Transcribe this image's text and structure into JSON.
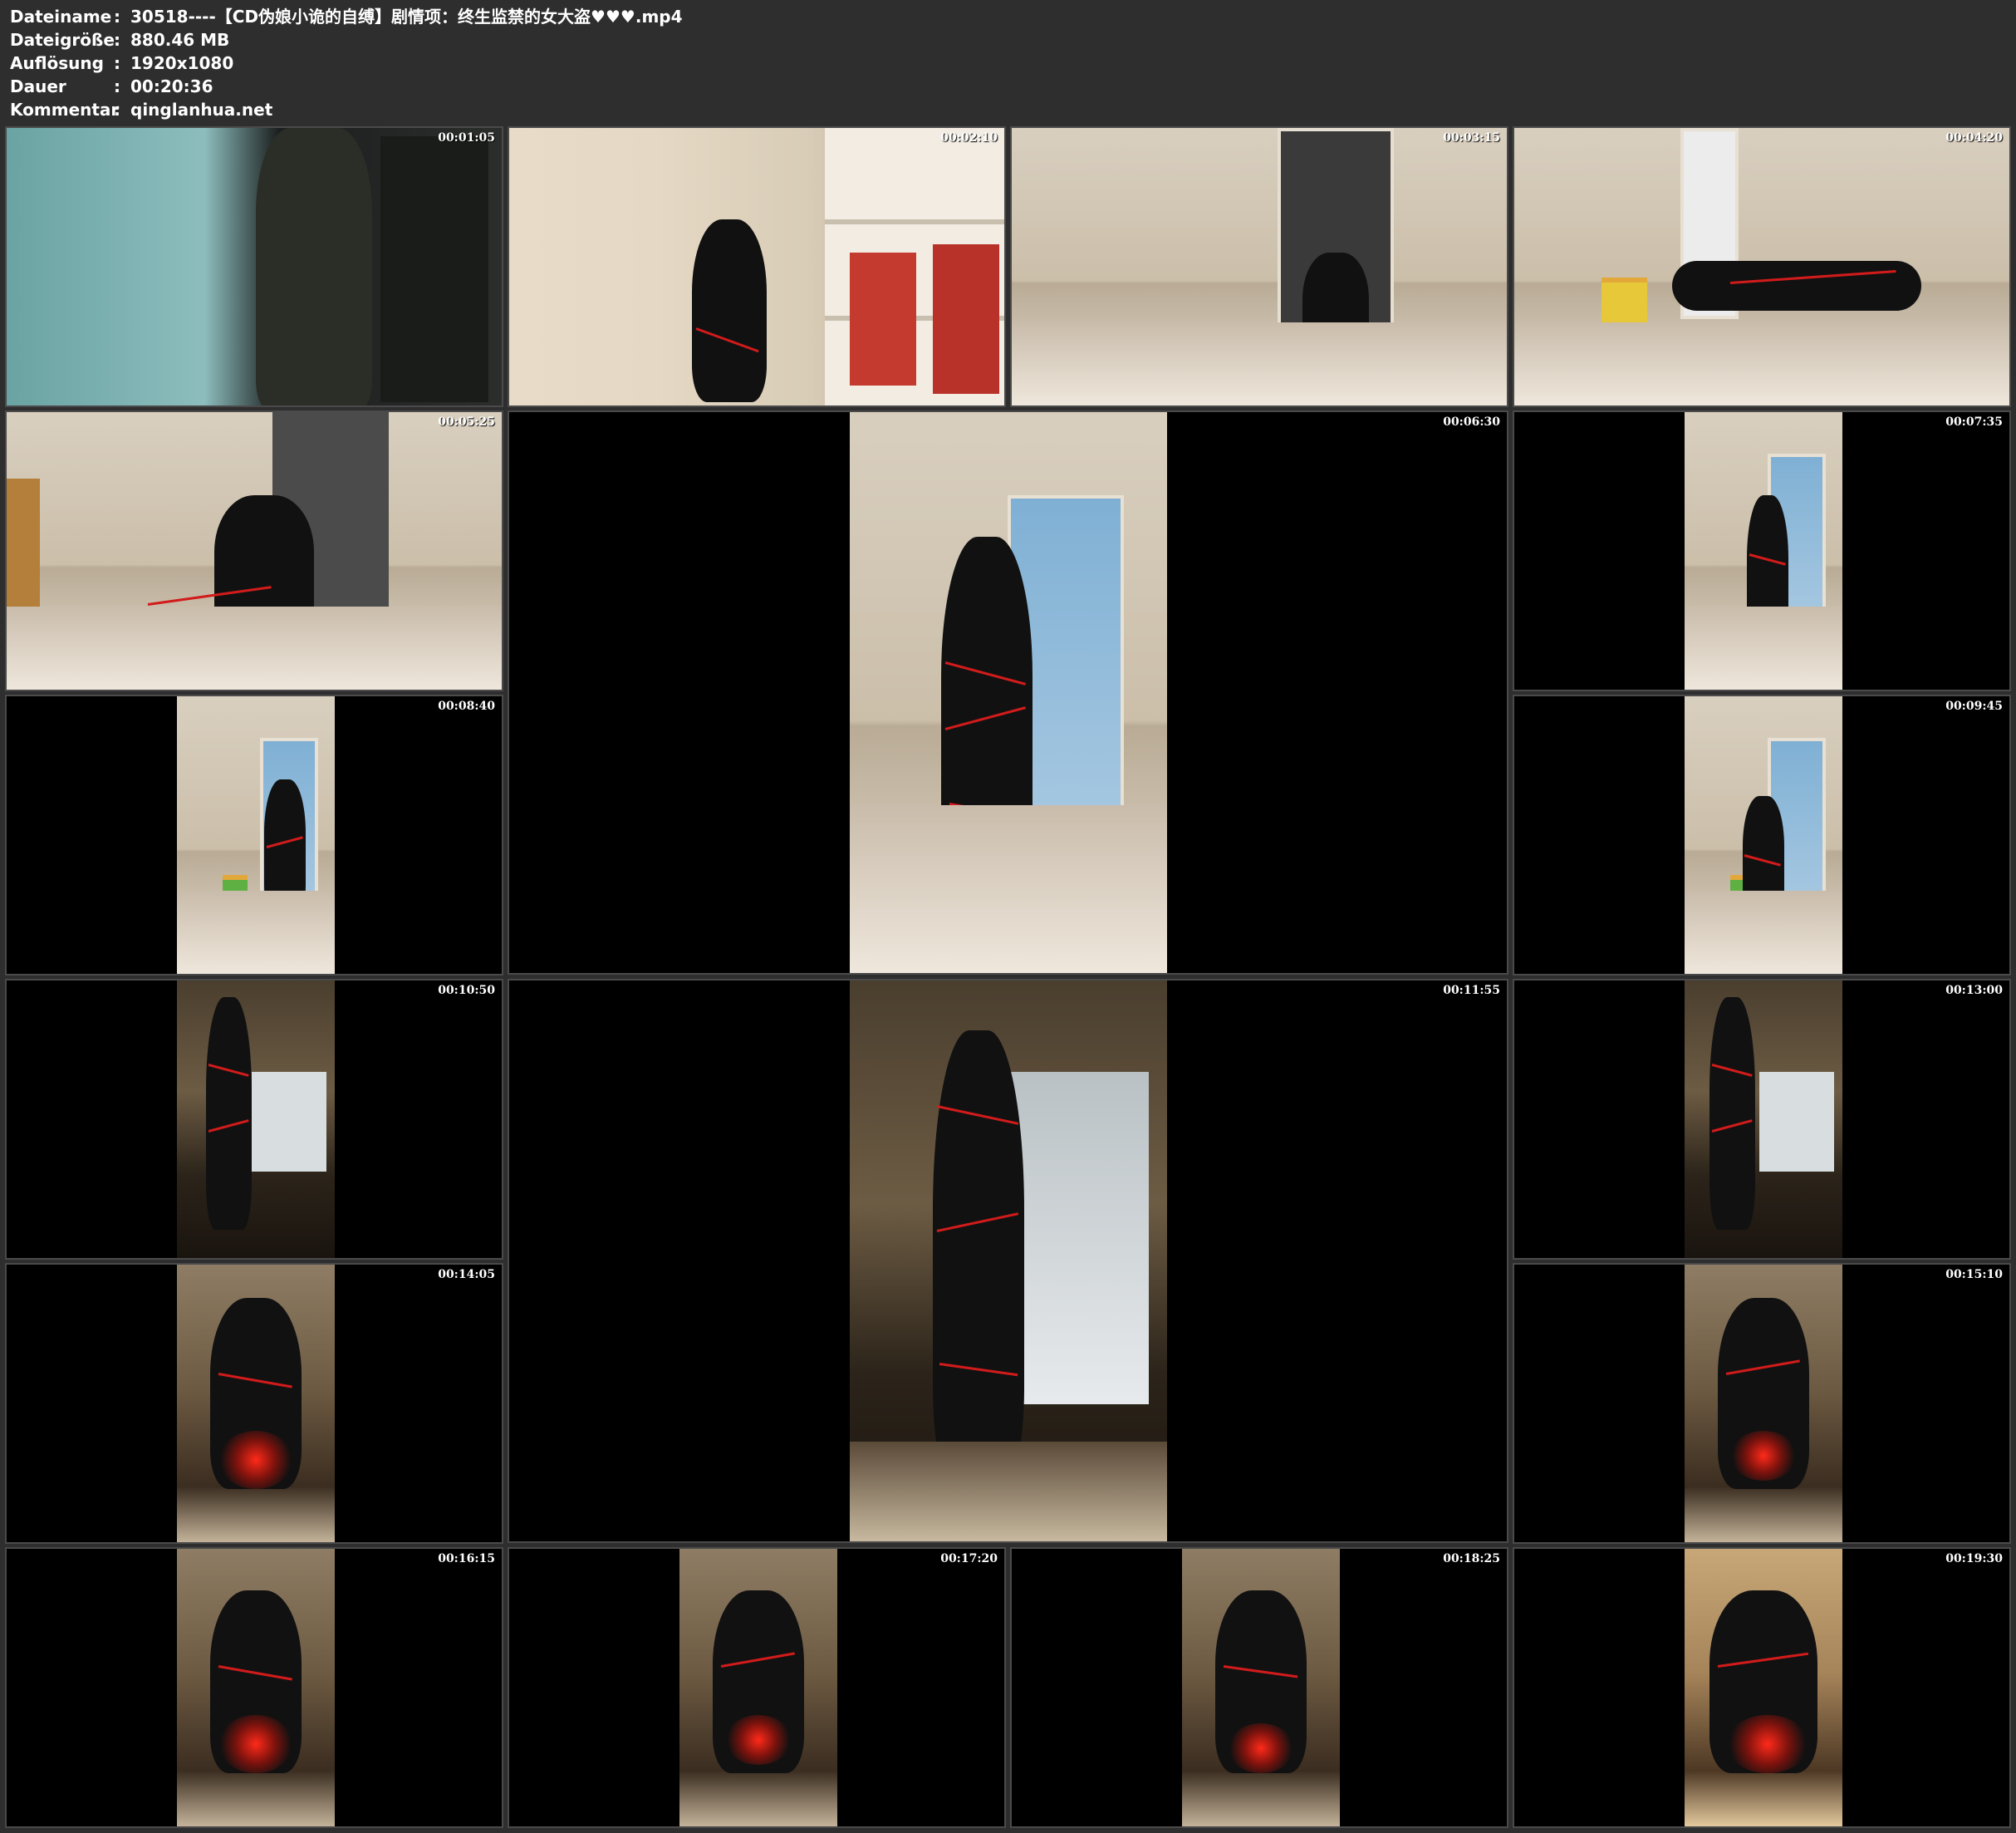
{
  "header": {
    "rows": [
      {
        "key": "Dateiname",
        "sep": ":",
        "value": "30518----【CD伪娘小诡的自缚】剧情项：终生监禁的女大盗♥♥♥.mp4"
      },
      {
        "key": "Dateigröße",
        "sep": ":",
        "value": "880.46 MB"
      },
      {
        "key": "Auflösung",
        "sep": ":",
        "value": "1920x1080"
      },
      {
        "key": "Dauer",
        "sep": ":",
        "value": "00:20:36"
      },
      {
        "key": "Kommentar",
        "sep": ":",
        "value": "qinglanhua.net"
      }
    ]
  },
  "thumbnails": [
    {
      "time": "00:01:05"
    },
    {
      "time": "00:02:10"
    },
    {
      "time": "00:03:15"
    },
    {
      "time": "00:04:20"
    },
    {
      "time": "00:05:25"
    },
    {
      "time": "00:06:30"
    },
    {
      "time": "00:07:35"
    },
    {
      "time": "00:08:40"
    },
    {
      "time": "00:09:45"
    },
    {
      "time": "00:10:50"
    },
    {
      "time": "00:11:55"
    },
    {
      "time": "00:13:00"
    },
    {
      "time": "00:14:05"
    },
    {
      "time": "00:15:10"
    },
    {
      "time": "00:16:15"
    },
    {
      "time": "00:17:20"
    },
    {
      "time": "00:18:25"
    },
    {
      "time": "00:19:30"
    }
  ],
  "colors": {
    "background": "#2e2e2e",
    "text": "#ffffff",
    "rope": "#d21b1b"
  }
}
